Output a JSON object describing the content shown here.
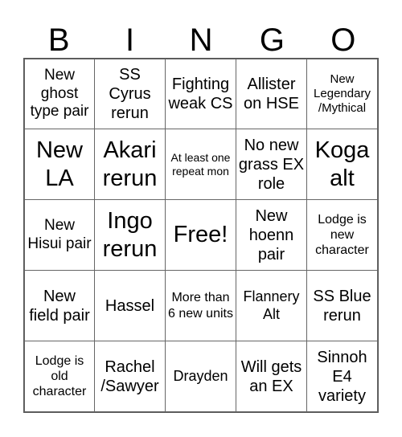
{
  "header": [
    "B",
    "I",
    "N",
    "G",
    "O"
  ],
  "cells": [
    "New ghost type pair",
    "SS Cyrus rerun",
    "Fighting weak CS",
    "Allister on HSE",
    "New Legendary /Mythical",
    "New LA",
    "Akari rerun",
    "At least one repeat mon",
    "No new grass EX role",
    "Koga alt",
    "New Hisui pair",
    "Ingo rerun",
    "Free!",
    "New hoenn pair",
    "Lodge is new character",
    "New field pair",
    "Hassel",
    "More than 6 new units",
    "Flannery Alt",
    "SS Blue rerun",
    "Lodge is old character",
    "Rachel /Sawyer",
    "Drayden",
    "Will gets an EX",
    "Sinnoh E4 variety"
  ]
}
